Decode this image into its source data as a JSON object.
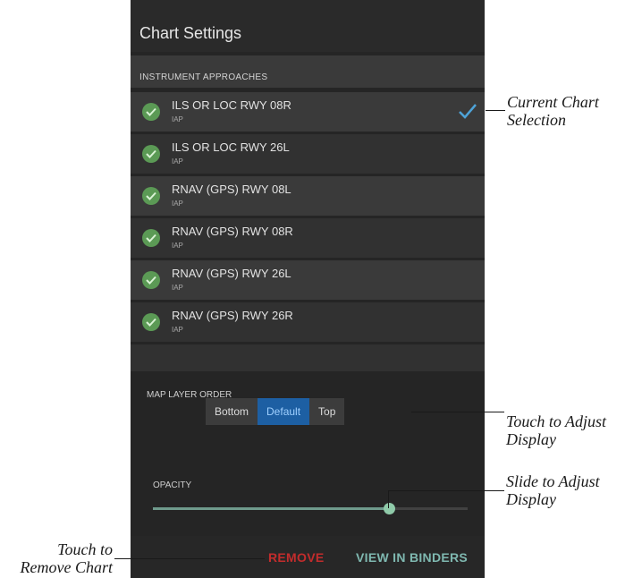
{
  "panel": {
    "title": "Chart Settings",
    "section_title": "INSTRUMENT APPROACHES",
    "approaches": [
      {
        "name": "ILS OR LOC RWY 08R",
        "type": "IAP",
        "selected": true
      },
      {
        "name": "ILS OR LOC RWY 26L",
        "type": "IAP",
        "selected": false
      },
      {
        "name": "RNAV (GPS) RWY 08L",
        "type": "IAP",
        "selected": false
      },
      {
        "name": "RNAV (GPS) RWY 08R",
        "type": "IAP",
        "selected": false
      },
      {
        "name": "RNAV (GPS) RWY 26L",
        "type": "IAP",
        "selected": false
      },
      {
        "name": "RNAV (GPS) RWY 26R",
        "type": "IAP",
        "selected": false
      }
    ],
    "map_layer_order": {
      "label": "MAP LAYER ORDER",
      "options": [
        "Bottom",
        "Default",
        "Top"
      ],
      "selected": "Default"
    },
    "opacity": {
      "label": "OPACITY",
      "value_fraction": 0.75
    },
    "footer": {
      "remove_label": "REMOVE",
      "view_in_binders_label": "VIEW IN BINDERS"
    }
  },
  "annotations": {
    "current_selection": [
      "Current Chart",
      "Selection"
    ],
    "adjust_display_touch": [
      "Touch to Adjust",
      "Display"
    ],
    "adjust_display_slide": [
      "Slide to Adjust",
      "Display"
    ],
    "remove_chart": [
      "Touch to",
      "Remove Chart"
    ]
  },
  "colors": {
    "panel_bg": "#252525",
    "check_green": "#5b9a55",
    "selected_check": "#4ea3d8",
    "segment_active": "#1d5fa3",
    "slider_thumb": "#8fcaa9",
    "remove_red": "#c22c2c",
    "binders_teal": "#7fb8b0"
  }
}
